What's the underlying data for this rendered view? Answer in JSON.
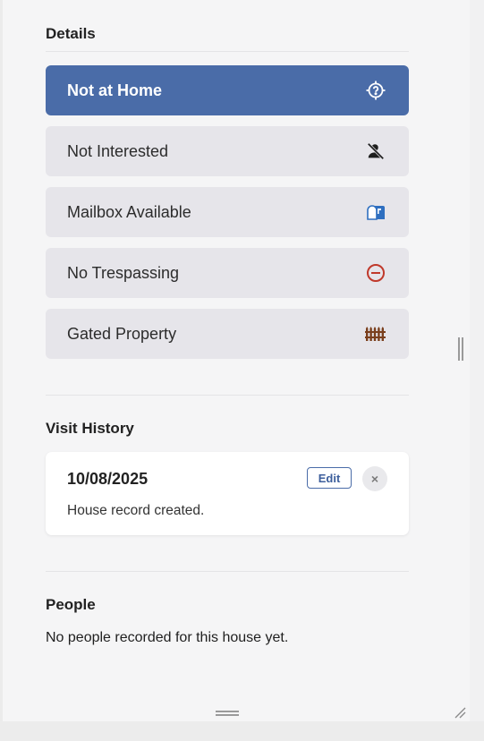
{
  "details": {
    "title": "Details",
    "options": [
      {
        "label": "Not at Home",
        "icon": "not-home-icon",
        "active": true
      },
      {
        "label": "Not Interested",
        "icon": "person-off-icon",
        "active": false
      },
      {
        "label": "Mailbox Available",
        "icon": "mailbox-icon",
        "active": false
      },
      {
        "label": "No Trespassing",
        "icon": "no-entry-icon",
        "active": false
      },
      {
        "label": "Gated Property",
        "icon": "fence-icon",
        "active": false
      }
    ]
  },
  "visit_history": {
    "title": "Visit History",
    "entries": [
      {
        "date": "10/08/2025",
        "note": "House record created.",
        "edit_label": "Edit",
        "delete_label": "×"
      }
    ]
  },
  "people": {
    "title": "People",
    "empty_text": "No people recorded for this house yet."
  },
  "colors": {
    "accent": "#4a6ca8",
    "option_bg": "#e6e5ea",
    "no_trespass_red": "#c0392b",
    "mailbox_blue": "#2f6fc0",
    "fence_brown": "#7a3f1d"
  }
}
